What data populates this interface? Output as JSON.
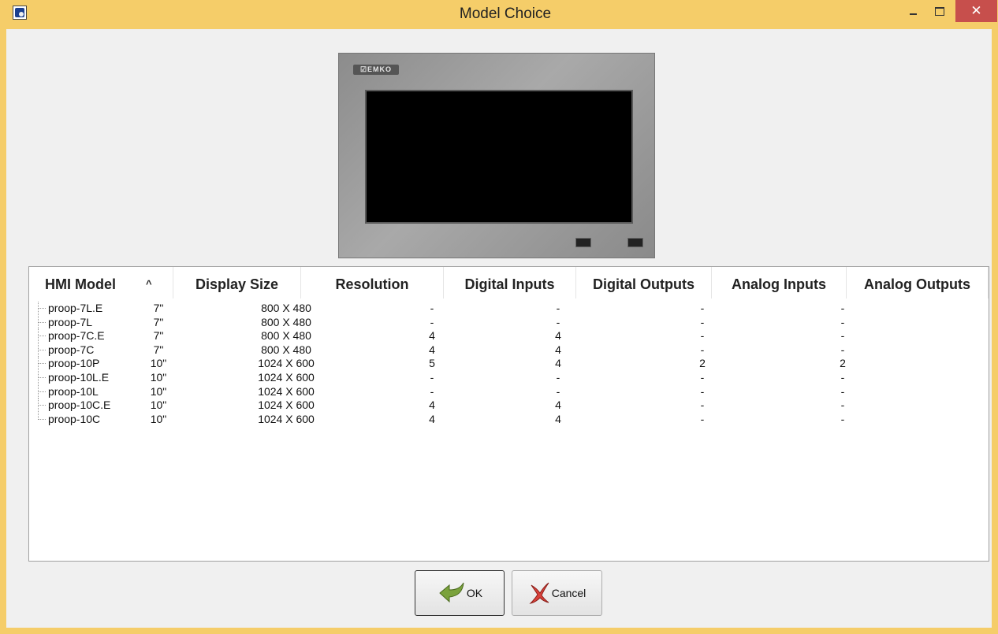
{
  "window": {
    "title": "Model Choice",
    "close_glyph": "✕"
  },
  "preview": {
    "logo_text": "EMKO"
  },
  "table": {
    "columns": [
      "HMI Model",
      "Display Size",
      "Resolution",
      "Digital Inputs",
      "Digital Outputs",
      "Analog Inputs",
      "Analog Outputs"
    ],
    "sort_indicator": "^",
    "rows": [
      [
        "proop-7L.E",
        "7\"",
        "800 X 480",
        "-",
        "-",
        "-",
        "-"
      ],
      [
        "proop-7L",
        "7\"",
        "800 X 480",
        "-",
        "-",
        "-",
        "-"
      ],
      [
        "proop-7C.E",
        "7\"",
        "800 X 480",
        "4",
        "4",
        "-",
        "-"
      ],
      [
        "proop-7C",
        "7\"",
        "800 X 480",
        "4",
        "4",
        "-",
        "-"
      ],
      [
        "proop-10P",
        "10\"",
        "1024 X 600",
        "5",
        "4",
        "2",
        "2"
      ],
      [
        "proop-10L.E",
        "10\"",
        "1024 X 600",
        "-",
        "-",
        "-",
        "-"
      ],
      [
        "proop-10L",
        "10\"",
        "1024 X 600",
        "-",
        "-",
        "-",
        "-"
      ],
      [
        "proop-10C.E",
        "10\"",
        "1024 X 600",
        "4",
        "4",
        "-",
        "-"
      ],
      [
        "proop-10C",
        "10\"",
        "1024 X 600",
        "4",
        "4",
        "-",
        "-"
      ]
    ]
  },
  "buttons": {
    "ok_label": "OK",
    "cancel_label": "Cancel",
    "ok_icon": "green-arrow-icon",
    "cancel_icon": "red-x-icon"
  },
  "colors": {
    "titlebar": "#f5cd69",
    "close": "#c74f4c"
  }
}
